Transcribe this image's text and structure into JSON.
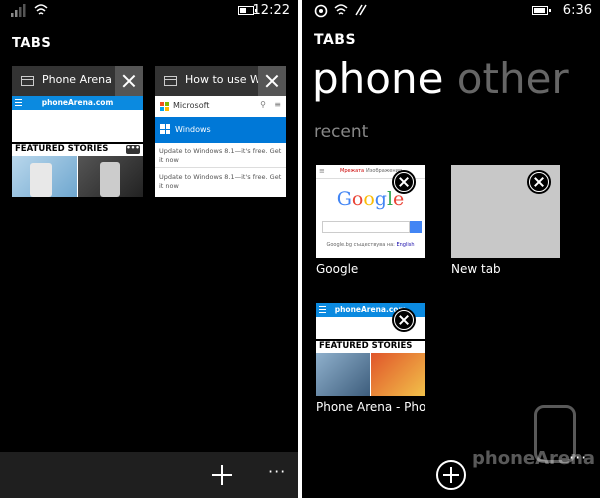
{
  "left": {
    "status_time": "12:22",
    "heading": "TABS",
    "tabs": [
      {
        "title": "Phone Arena - ",
        "site_logo": "phoneArena.com",
        "section": "FEATURED STORIES",
        "more": "•••"
      },
      {
        "title": "How to use W",
        "brand": "Microsoft",
        "bar_label": "Windows",
        "update_lines": [
          "Update to Windows 8.1—it's free. Get it now",
          "Update to Windows 8.1—it's free. Get it now"
        ]
      }
    ],
    "appbar": {
      "more": "···"
    }
  },
  "right": {
    "status_time": "6:36",
    "heading": "TABS",
    "pivot_active": "phone",
    "pivot_inactive": "other",
    "section_label": "recent",
    "thumbs": [
      {
        "label": "Google",
        "logo": "Google",
        "tab_a": "Мрежата",
        "tab_b": "Изображения",
        "foot": "Google.bg съществува на:",
        "foot_link": "English"
      },
      {
        "label": "New tab"
      },
      {
        "label": "Phone Arena - Phor",
        "site_logo": "phoneArena.com",
        "section": "FEATURED STORIES"
      }
    ],
    "appbar": {
      "more": "···"
    },
    "watermark": "phoneArena"
  },
  "colors": {
    "background": "#000000",
    "divider": "#ffffff",
    "tab_header": "#333333",
    "close_box": "#555555",
    "windows_blue": "#0078d7",
    "phonearena_blue": "#0b8ae0",
    "pivot_inactive": "#666666",
    "section_label": "#888888",
    "appbar": "#1f1f1f",
    "new_tab_gray": "#c8c8c8"
  },
  "icons": [
    "signal-icon",
    "wifi-icon",
    "battery-icon",
    "page-icon",
    "close-icon",
    "plus-icon",
    "more-icon",
    "add-circle-icon"
  ]
}
